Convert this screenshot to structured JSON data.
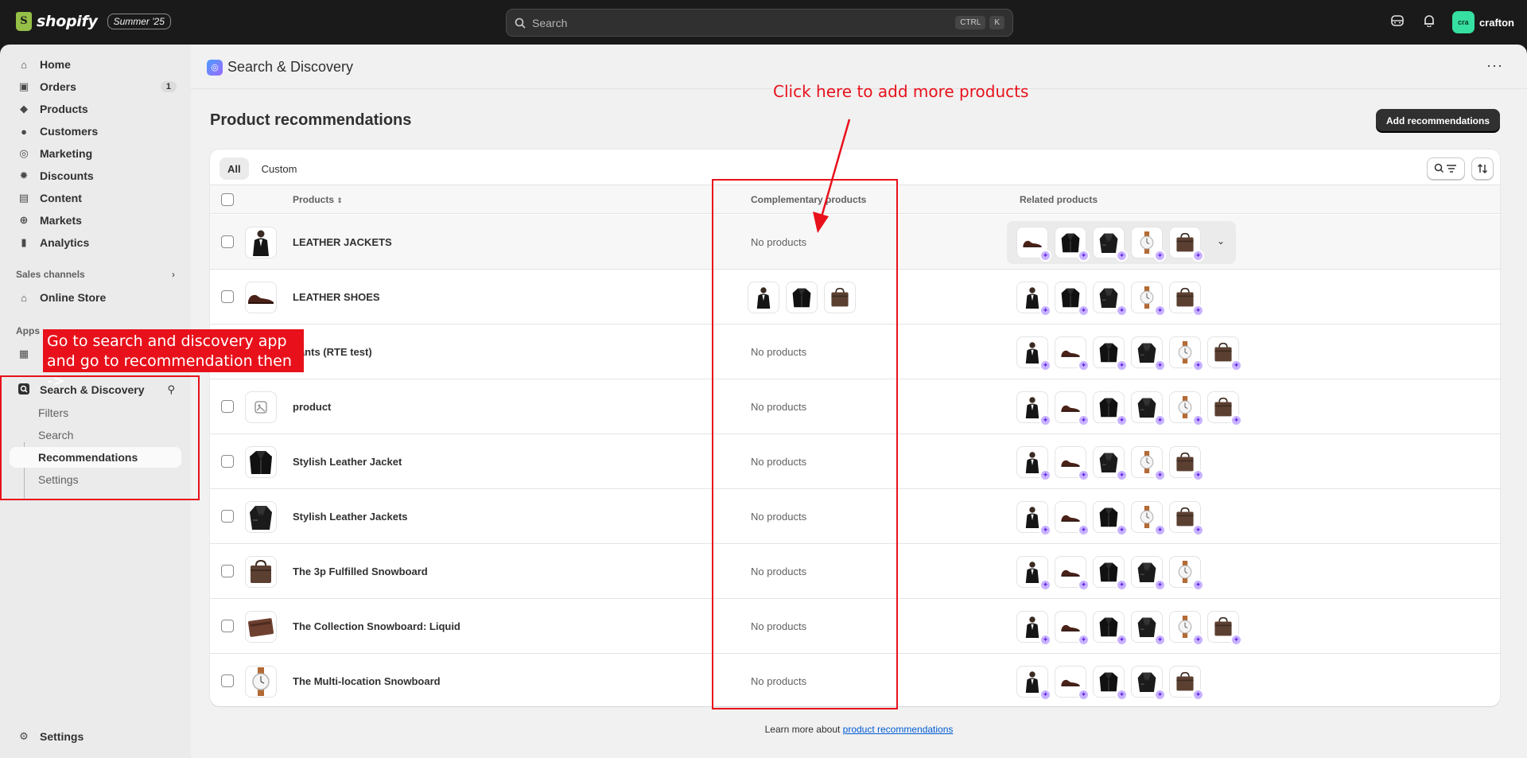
{
  "topbar": {
    "brand": "shopify",
    "badge": "Summer '25",
    "search_placeholder": "Search",
    "shortcut": [
      "CTRL",
      "K"
    ],
    "user_initials": "cra",
    "user_name": "crafton"
  },
  "sidebar": {
    "items": [
      {
        "label": "Home",
        "icon": "home-icon"
      },
      {
        "label": "Orders",
        "icon": "orders-icon",
        "count": "1"
      },
      {
        "label": "Products",
        "icon": "tag-icon"
      },
      {
        "label": "Customers",
        "icon": "person-icon"
      },
      {
        "label": "Marketing",
        "icon": "target-icon"
      },
      {
        "label": "Discounts",
        "icon": "discount-icon"
      },
      {
        "label": "Content",
        "icon": "content-icon"
      },
      {
        "label": "Markets",
        "icon": "globe-icon"
      },
      {
        "label": "Analytics",
        "icon": "bar-chart-icon"
      }
    ],
    "sales_channels_label": "Sales channels",
    "online_store": "Online Store",
    "apps_label": "Apps",
    "app": "Search & Discovery",
    "app_subitems": [
      "Filters",
      "Search",
      "Recommendations",
      "Settings"
    ],
    "settings": "Settings"
  },
  "main": {
    "app_title": "Search & Discovery",
    "page_title": "Product recommendations",
    "add_button": "Add recommendations",
    "tabs": [
      "All",
      "Custom"
    ],
    "columns": {
      "products": "Products",
      "complementary": "Complementary products",
      "related": "Related products"
    },
    "no_products": "No products",
    "rows": [
      {
        "name": "LEATHER JACKETS",
        "thumb": "man",
        "comp": [],
        "related": [
          "shoe",
          "jacket",
          "jacket2",
          "watch",
          "bag"
        ]
      },
      {
        "name": "LEATHER SHOES",
        "thumb": "shoe",
        "comp": [
          "man",
          "jacket",
          "bag"
        ],
        "related": [
          "man",
          "jacket",
          "jacket2",
          "watch",
          "bag"
        ]
      },
      {
        "name": "pants (RTE test)",
        "thumb": "pants",
        "comp": [],
        "related": [
          "man",
          "shoe",
          "jacket",
          "jacket2",
          "watch",
          "bag"
        ]
      },
      {
        "name": "product",
        "thumb": "placeholder",
        "comp": [],
        "related": [
          "man",
          "shoe",
          "jacket",
          "jacket2",
          "watch",
          "bag"
        ]
      },
      {
        "name": "Stylish Leather Jacket",
        "thumb": "jacket",
        "comp": [],
        "related": [
          "man",
          "shoe",
          "jacket2",
          "watch",
          "bag"
        ]
      },
      {
        "name": "Stylish Leather Jackets",
        "thumb": "jacket2",
        "comp": [],
        "related": [
          "man",
          "shoe",
          "jacket",
          "watch",
          "bag"
        ]
      },
      {
        "name": "The 3p Fulfilled Snowboard",
        "thumb": "bag",
        "comp": [],
        "related": [
          "man",
          "shoe",
          "jacket",
          "jacket2",
          "watch"
        ]
      },
      {
        "name": "The Collection Snowboard: Liquid",
        "thumb": "wallet",
        "comp": [],
        "related": [
          "man",
          "shoe",
          "jacket",
          "jacket2",
          "watch",
          "bag"
        ]
      },
      {
        "name": "The Multi-location Snowboard",
        "thumb": "watch",
        "comp": [],
        "related": [
          "man",
          "shoe",
          "jacket",
          "jacket2",
          "bag"
        ]
      }
    ],
    "footer_text": "Learn more about ",
    "footer_link": "product recommendations"
  },
  "annotations": {
    "callout_line1": "Go to search and discovery app",
    "callout_line2": "and go to recommendation then ->",
    "hint": "Click here to add more products"
  },
  "colors": {
    "accent": "#e8111b",
    "brand": "#95bf47",
    "primary": "#303030",
    "link": "#005bd3"
  }
}
